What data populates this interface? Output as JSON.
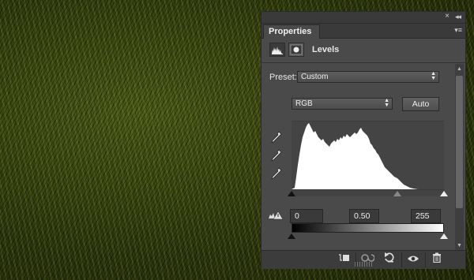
{
  "panel": {
    "tab_label": "Properties",
    "title": "Levels",
    "collapse_glyph": "◂◂",
    "close_glyph": "×",
    "menu_glyph": "▾≡"
  },
  "controls": {
    "preset_label": "Preset:",
    "preset_value": "Custom",
    "channel_value": "RGB",
    "auto_label": "Auto"
  },
  "input_levels": {
    "black": "0",
    "gamma": "0.50",
    "white": "255"
  },
  "icons": {
    "header": [
      "levels-adjustment-icon",
      "layer-mask-icon"
    ],
    "eyedroppers": [
      "black-point-eyedropper-icon",
      "gray-point-eyedropper-icon",
      "white-point-eyedropper-icon"
    ],
    "footer": [
      "clip-to-layer-icon",
      "view-previous-state-icon",
      "reset-adjustments-icon",
      "toggle-visibility-icon",
      "delete-layer-icon"
    ],
    "warning": "clipping-warning-icon"
  },
  "colors": {
    "panel_bg": "#4a4a4a",
    "histogram_fill": "#ffffff",
    "canvas_grass": "#3a4a10"
  }
}
